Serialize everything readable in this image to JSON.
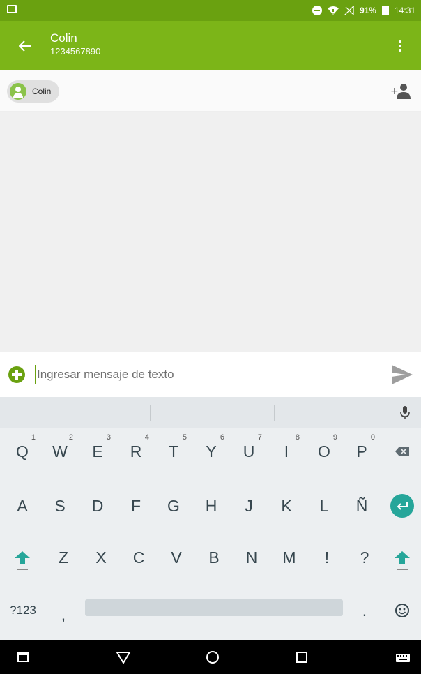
{
  "status_bar": {
    "battery": "91%",
    "time": "14:31",
    "icons": [
      "gallery-notification-icon",
      "do-not-disturb-icon",
      "wifi-icon",
      "no-signal-icon",
      "battery-icon"
    ]
  },
  "header": {
    "title": "Colin",
    "subtitle": "1234567890",
    "back_icon": "arrow-left-icon",
    "menu_icon": "more-vert-icon"
  },
  "recipients": {
    "chip_label": "Colin",
    "add_icon": "add-person-icon"
  },
  "compose": {
    "placeholder": "Ingresar mensaje de texto",
    "value": "",
    "attach_icon": "add-circle-icon",
    "send_icon": "send-icon"
  },
  "keyboard": {
    "row1": [
      {
        "label": "Q",
        "hint": "1"
      },
      {
        "label": "W",
        "hint": "2"
      },
      {
        "label": "E",
        "hint": "3"
      },
      {
        "label": "R",
        "hint": "4"
      },
      {
        "label": "T",
        "hint": "5"
      },
      {
        "label": "Y",
        "hint": "6"
      },
      {
        "label": "U",
        "hint": "7"
      },
      {
        "label": "I",
        "hint": "8"
      },
      {
        "label": "O",
        "hint": "9"
      },
      {
        "label": "P",
        "hint": "0"
      }
    ],
    "row2": [
      "A",
      "S",
      "D",
      "F",
      "G",
      "H",
      "J",
      "K",
      "L",
      "Ñ"
    ],
    "row3": [
      "Z",
      "X",
      "C",
      "V",
      "B",
      "N",
      "M",
      "!",
      "?"
    ],
    "symbols_label": "?123",
    "comma_label": ",",
    "period_label": ".",
    "accent_color": "#26a69a"
  },
  "nav": {
    "icons": [
      "recent-apps-icon",
      "back-icon",
      "home-icon",
      "overview-icon",
      "keyboard-switch-icon"
    ]
  },
  "colors": {
    "status_bar": "#6aa110",
    "app_bar": "#7cb518",
    "accent": "#6aa110"
  }
}
